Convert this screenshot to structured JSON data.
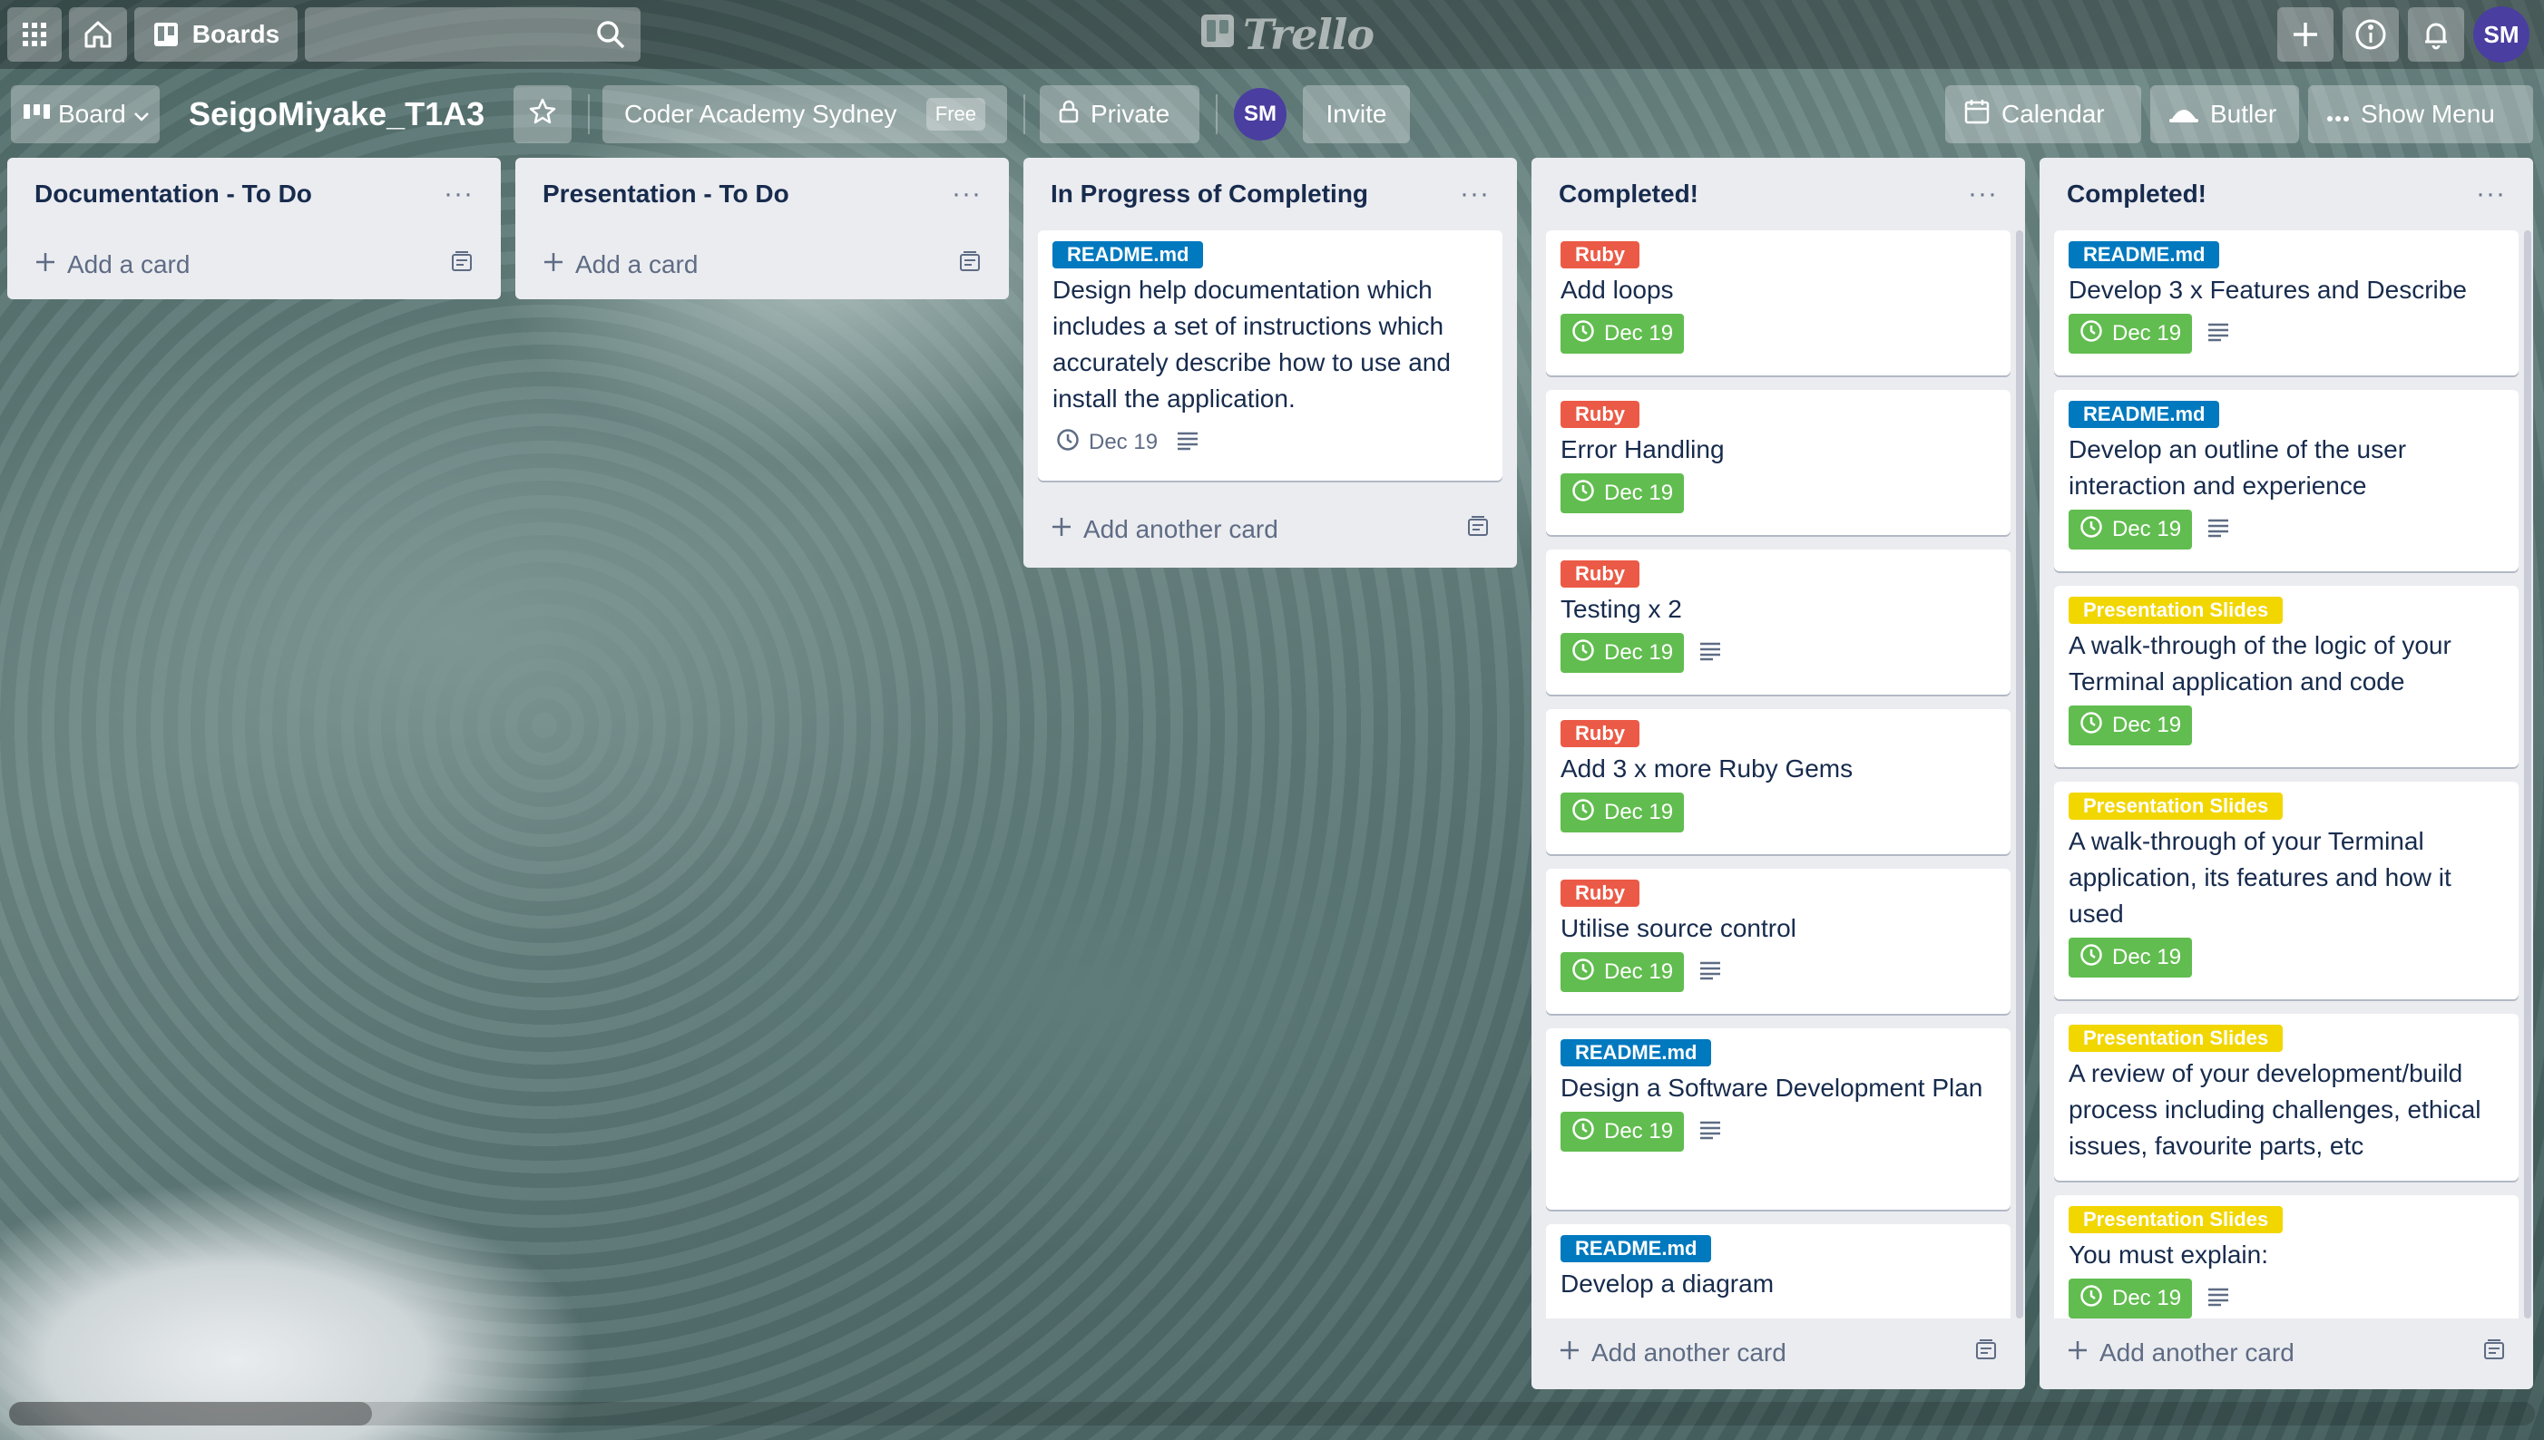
{
  "header": {
    "boards_label": "Boards",
    "search_placeholder": "",
    "logo_text": "Trello",
    "user_initials": "SM"
  },
  "board": {
    "view_label": "Board",
    "title": "SeigoMiyake_T1A3",
    "team_name": "Coder Academy Sydney",
    "team_plan": "Free",
    "visibility": "Private",
    "member_initials": "SM",
    "invite_label": "Invite",
    "calendar_label": "Calendar",
    "butler_label": "Butler",
    "menu_label": "Show Menu"
  },
  "colors": {
    "label_blue": "#0079bf",
    "label_red": "#eb5a46",
    "label_yellow": "#f2d600",
    "due_complete": "#61bd4f",
    "list_bg": "#ebecf0"
  },
  "lists": [
    {
      "title": "Documentation - To Do",
      "menu": "···",
      "add_label": "Add a card",
      "cards": []
    },
    {
      "title": "Presentation - To Do",
      "menu": "···",
      "add_label": "Add a card",
      "cards": []
    },
    {
      "title": "In Progress of Completing",
      "menu": "···",
      "add_label": "Add another card",
      "cards": [
        {
          "label": "README.md",
          "title": "Design help documentation which includes a set of instructions which accurately describe how to use and install the application.",
          "due": "Dec 19"
        }
      ]
    },
    {
      "title": "Completed!",
      "menu": "···",
      "add_label": "Add another card",
      "cards": [
        {
          "label": "Ruby",
          "title": "Add loops",
          "due": "Dec 19"
        },
        {
          "label": "Ruby",
          "title": "Error Handling",
          "due": "Dec 19"
        },
        {
          "label": "Ruby",
          "title": "Testing x 2",
          "due": "Dec 19"
        },
        {
          "label": "Ruby",
          "title": "Add 3 x more Ruby Gems",
          "due": "Dec 19"
        },
        {
          "label": "Ruby",
          "title": "Utilise source control",
          "due": "Dec 19"
        },
        {
          "label": "README.md",
          "title": "Design a Software Development Plan",
          "due": "Dec 19"
        },
        {
          "label": "README.md",
          "title": "Develop a diagram",
          "due": ""
        }
      ]
    },
    {
      "title": "Completed!",
      "menu": "···",
      "add_label": "Add another card",
      "cards": [
        {
          "label": "README.md",
          "title": "Develop 3 x Features and Describe",
          "due": "Dec 19"
        },
        {
          "label": "README.md",
          "title": "Develop an outline of the user interaction and experience",
          "due": "Dec 19"
        },
        {
          "label": "Presentation Slides",
          "title": "A walk-through of the logic of your Terminal application and code",
          "due": "Dec 19"
        },
        {
          "label": "Presentation Slides",
          "title": "A walk-through of your Terminal application, its features and how it used",
          "due": "Dec 19"
        },
        {
          "label": "Presentation Slides",
          "title": "A review of your development/build process including challenges, ethical issues, favourite parts, etc",
          "due": ""
        },
        {
          "label": "Presentation Slides",
          "title": "You must explain:",
          "due": "Dec 19"
        }
      ]
    }
  ]
}
